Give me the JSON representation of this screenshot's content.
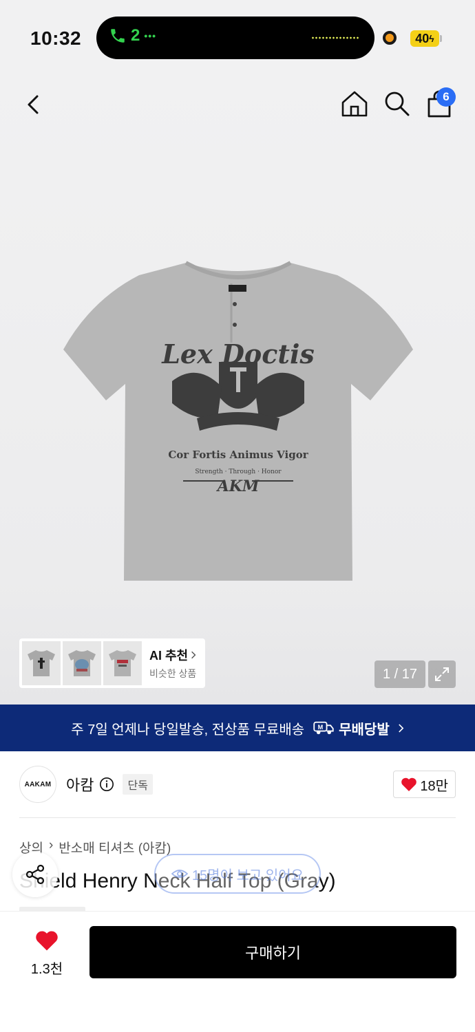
{
  "status_bar": {
    "time": "10:32",
    "call_count": "2",
    "battery": "40"
  },
  "nav": {
    "cart_count": "6"
  },
  "gallery": {
    "counter": "1 / 17"
  },
  "ai_recommend": {
    "title": "AI 추천",
    "subtitle": "비슷한 상품"
  },
  "banner": {
    "text": "주 7일 언제나 당일발송, 전상품 무료배송",
    "tag": "무배당발",
    "tag_icon": "M"
  },
  "brand": {
    "logo_text": "AAKAM",
    "name": "아캄",
    "badge": "단독",
    "likes": "18만"
  },
  "breadcrumb": {
    "category": "상의",
    "subcategory": "반소매 티셔츠 (아캄)"
  },
  "product": {
    "title": "Shield Henry Neck Half Top (Gray)"
  },
  "viewers": "15명이 보고 있어요",
  "bottom": {
    "wish_count": "1.3천",
    "buy_label": "구매하기"
  },
  "colors": {
    "banner": "#0d2a78",
    "badge": "#2a6df5",
    "heart": "#e8132b",
    "call": "#33d24e"
  }
}
